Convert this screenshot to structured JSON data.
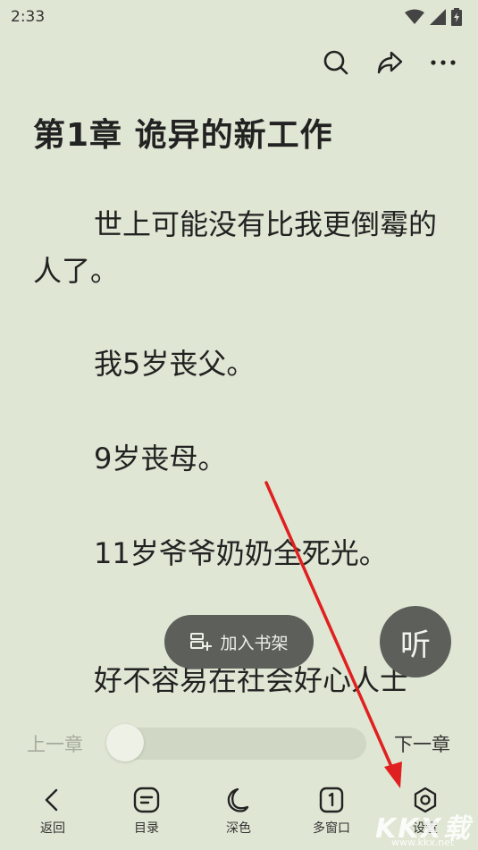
{
  "status_bar": {
    "time": "2:33"
  },
  "toolbar": {
    "icons": [
      "search-icon",
      "share-icon",
      "more-icon"
    ]
  },
  "reader": {
    "chapter_title": "第1章 诡异的新工作",
    "paragraphs": [
      "世上可能没有比我更倒霉的人了。",
      "我5岁丧父。",
      "9岁丧母。",
      "11岁爷爷奶奶全死光。",
      "好不容易在社会好心人士"
    ]
  },
  "actions": {
    "add_to_shelf": "加入书架",
    "listen": "听"
  },
  "progress": {
    "prev_chapter": "上一章",
    "next_chapter": "下一章",
    "value": 0.0
  },
  "bottom_nav": {
    "items": [
      {
        "label": "返回",
        "icon": "back-icon"
      },
      {
        "label": "目录",
        "icon": "catalog-icon"
      },
      {
        "label": "深色",
        "icon": "moon-icon"
      },
      {
        "label": "多窗口",
        "icon": "multi-window-icon"
      },
      {
        "label": "设置",
        "icon": "settings-icon"
      }
    ]
  },
  "watermark": {
    "text": "KKX载",
    "url": "www.kkx.net"
  },
  "colors": {
    "background": "#dfe6d3",
    "pill": "#5c5f5a",
    "arrow": "#e02020"
  }
}
